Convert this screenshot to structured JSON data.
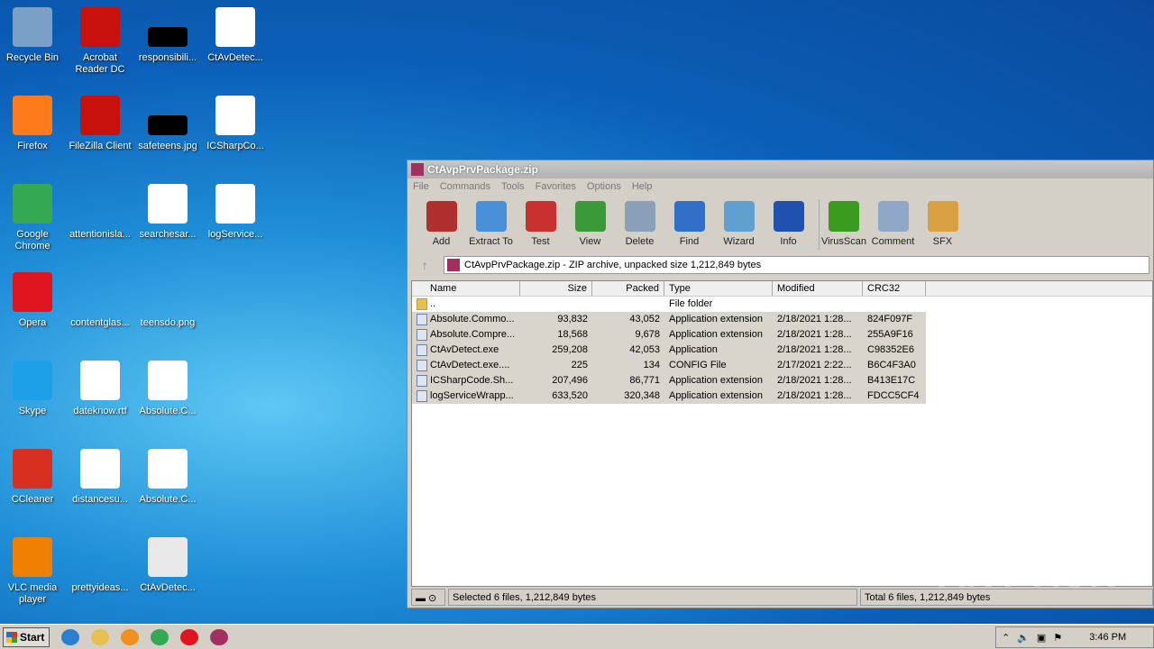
{
  "desktop": {
    "icons": [
      {
        "label": "Recycle Bin",
        "color": "#7aa0c8"
      },
      {
        "label": "Firefox",
        "color": "#ff7a1a"
      },
      {
        "label": "Google Chrome",
        "color": "#34a853"
      },
      {
        "label": "Opera",
        "color": "#e0141e"
      },
      {
        "label": "Skype",
        "color": "#1ea0e8"
      },
      {
        "label": "CCleaner",
        "color": "#d83020"
      },
      {
        "label": "VLC media player",
        "color": "#f08000"
      },
      {
        "label": "Acrobat Reader DC",
        "color": "#c8100c"
      },
      {
        "label": "FileZilla Client",
        "color": "#c8100c"
      },
      {
        "label": "attentionisla...",
        "color": "transparent"
      },
      {
        "label": "contentglas...",
        "color": "transparent"
      },
      {
        "label": "dateknow.rtf",
        "color": "#ffffff"
      },
      {
        "label": "distancesu...",
        "color": "#ffffff"
      },
      {
        "label": "prettyideas...",
        "color": "transparent"
      },
      {
        "label": "responsibili...",
        "color": "#000000"
      },
      {
        "label": "safeteens.jpg",
        "color": "#000000"
      },
      {
        "label": "searchesar...",
        "color": "#ffffff"
      },
      {
        "label": "teensdo.png",
        "color": "transparent"
      },
      {
        "label": "Absolute.C...",
        "color": "#ffffff"
      },
      {
        "label": "Absolute.C...",
        "color": "#ffffff"
      },
      {
        "label": "CtAvDetec...",
        "color": "#e8e8e8"
      },
      {
        "label": "CtAvDetec...",
        "color": "#ffffff"
      },
      {
        "label": "ICSharpCo...",
        "color": "#ffffff"
      },
      {
        "label": "logService...",
        "color": "#ffffff"
      }
    ]
  },
  "window": {
    "title": "CtAvpPrvPackage.zip",
    "menu": [
      "File",
      "Commands",
      "Tools",
      "Favorites",
      "Options",
      "Help"
    ],
    "toolbar": [
      {
        "label": "Add",
        "icon": "add-icon",
        "color": "#b03030"
      },
      {
        "label": "Extract To",
        "icon": "folder-icon",
        "color": "#4a90d8"
      },
      {
        "label": "Test",
        "icon": "clipboard-check-icon",
        "color": "#c83030"
      },
      {
        "label": "View",
        "icon": "book-icon",
        "color": "#3a9a3a"
      },
      {
        "label": "Delete",
        "icon": "trash-icon",
        "color": "#8aa0b8"
      },
      {
        "label": "Find",
        "icon": "magnifier-icon",
        "color": "#3070c8"
      },
      {
        "label": "Wizard",
        "icon": "wand-icon",
        "color": "#60a0d0"
      },
      {
        "label": "Info",
        "icon": "info-icon",
        "color": "#2050b0"
      },
      {
        "label": "VirusScan",
        "icon": "bug-icon",
        "color": "#3a9a20"
      },
      {
        "label": "Comment",
        "icon": "comment-icon",
        "color": "#90a8c8"
      },
      {
        "label": "SFX",
        "icon": "sfx-icon",
        "color": "#d8a040"
      }
    ],
    "address": "CtAvpPrvPackage.zip - ZIP archive, unpacked size 1,212,849 bytes",
    "columns": [
      "Name",
      "Size",
      "Packed",
      "Type",
      "Modified",
      "CRC32"
    ],
    "rows": [
      {
        "name": "..",
        "size": "",
        "packed": "",
        "type": "File folder",
        "modified": "",
        "crc": ""
      },
      {
        "name": "Absolute.Commo...",
        "size": "93,832",
        "packed": "43,052",
        "type": "Application extension",
        "modified": "2/18/2021 1:28...",
        "crc": "824F097F"
      },
      {
        "name": "Absolute.Compre...",
        "size": "18,568",
        "packed": "9,678",
        "type": "Application extension",
        "modified": "2/18/2021 1:28...",
        "crc": "255A9F16"
      },
      {
        "name": "CtAvDetect.exe",
        "size": "259,208",
        "packed": "42,053",
        "type": "Application",
        "modified": "2/18/2021 1:28...",
        "crc": "C98352E6"
      },
      {
        "name": "CtAvDetect.exe....",
        "size": "225",
        "packed": "134",
        "type": "CONFIG File",
        "modified": "2/17/2021 2:22...",
        "crc": "B6C4F3A0"
      },
      {
        "name": "ICSharpCode.Sh...",
        "size": "207,496",
        "packed": "86,771",
        "type": "Application extension",
        "modified": "2/18/2021 1:28...",
        "crc": "B413E17C"
      },
      {
        "name": "logServiceWrapp...",
        "size": "633,520",
        "packed": "320,348",
        "type": "Application extension",
        "modified": "2/18/2021 1:28...",
        "crc": "FDCC5CF4"
      }
    ],
    "status_left": "Selected 6 files, 1,212,849 bytes",
    "status_right": "Total 6 files, 1,212,849 bytes"
  },
  "taskbar": {
    "start": "Start",
    "clock": "3:46 PM",
    "apps": [
      {
        "name": "ie",
        "color": "#2a80d0"
      },
      {
        "name": "explorer",
        "color": "#e8c050"
      },
      {
        "name": "media-player",
        "color": "#f09020"
      },
      {
        "name": "chrome",
        "color": "#34a853"
      },
      {
        "name": "opera",
        "color": "#e0141e"
      },
      {
        "name": "winrar",
        "color": "#a03060"
      }
    ]
  },
  "watermark": "ANY RUN"
}
